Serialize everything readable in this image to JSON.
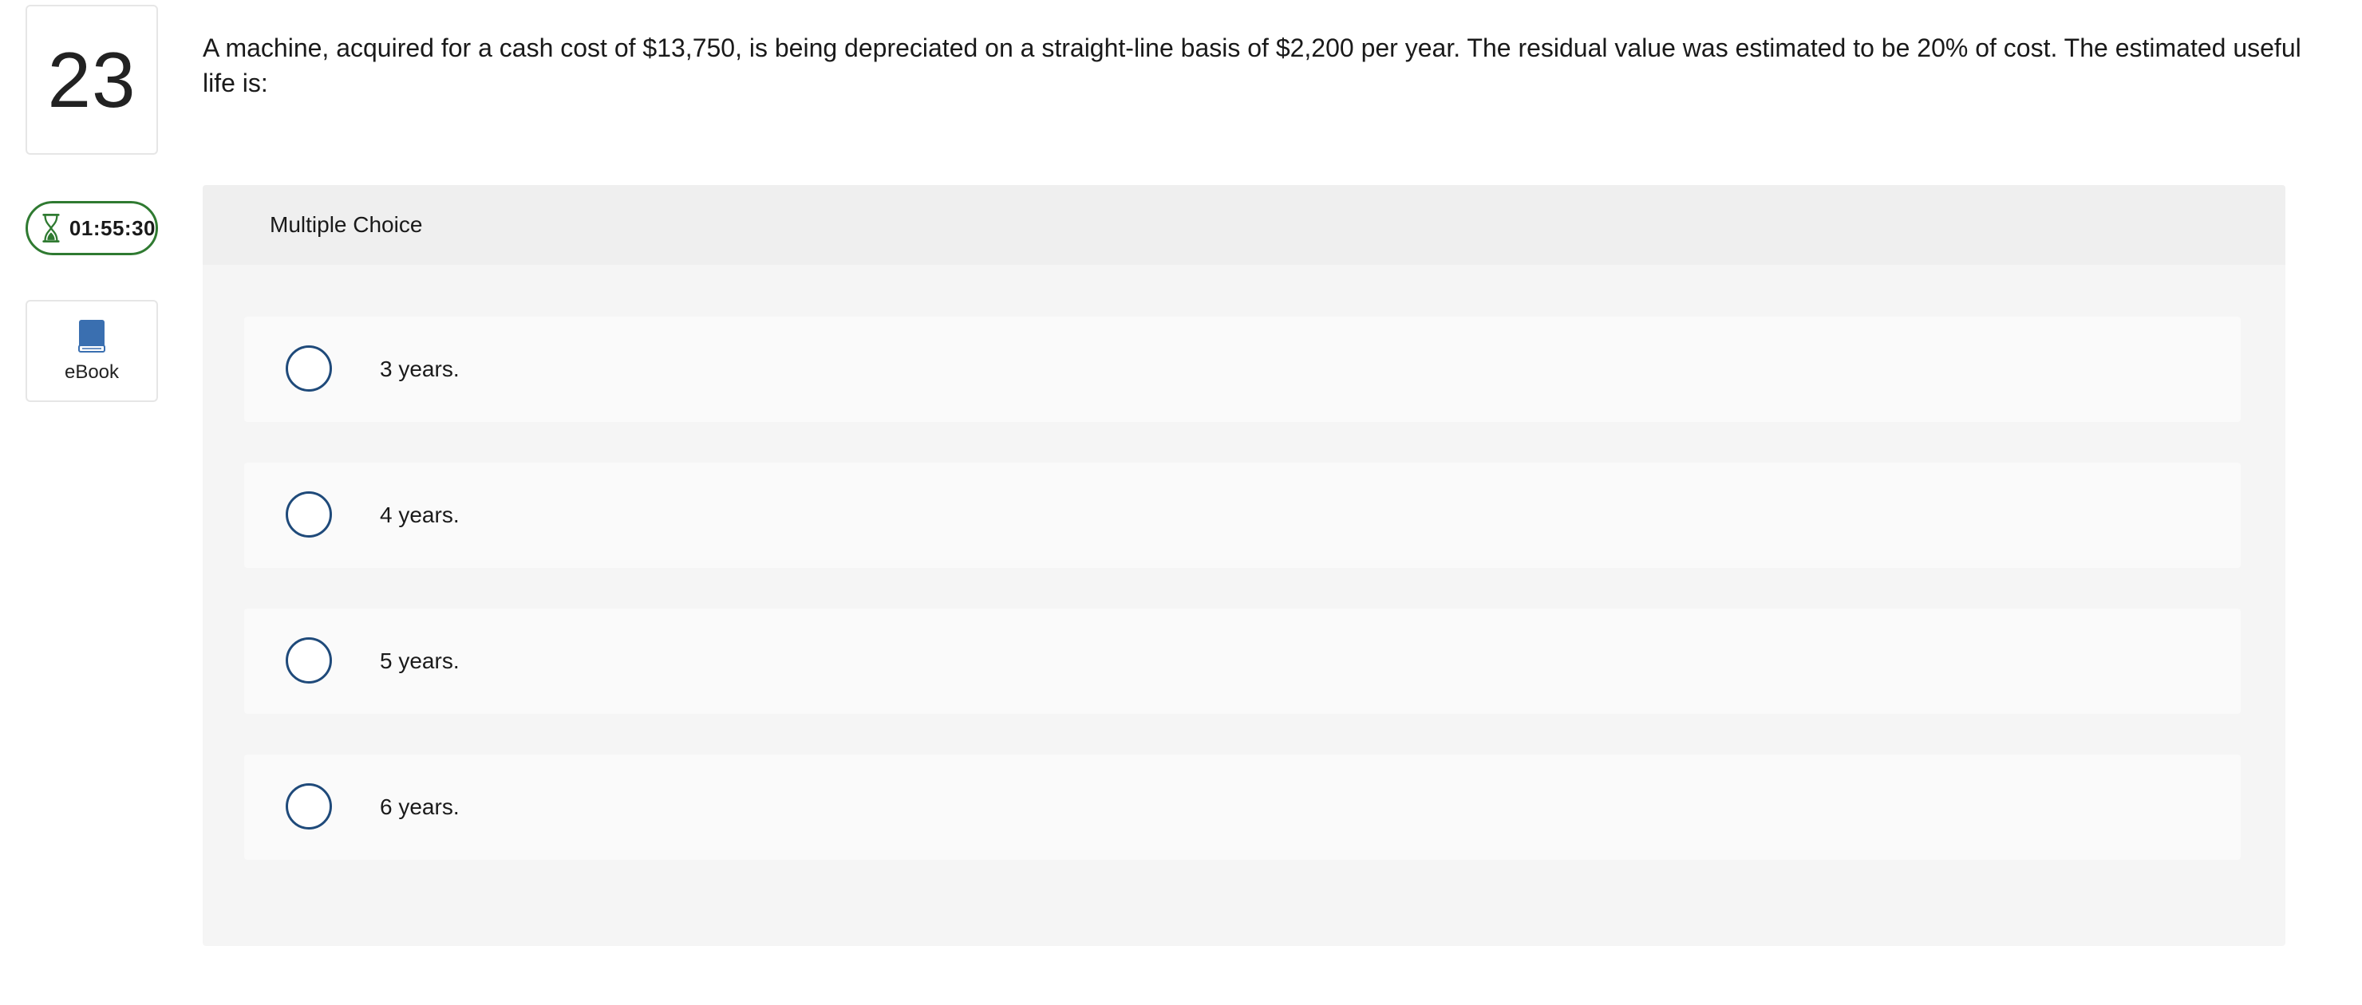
{
  "question": {
    "number": "23",
    "text": "A machine, acquired for a cash cost of $13,750, is being depreciated on a straight-line basis of $2,200 per year. The residual value was estimated to be 20% of cost. The estimated useful life is:"
  },
  "timer": {
    "value": "01:55:30",
    "icon": "hourglass-icon",
    "color": "#2f7a31"
  },
  "ebook": {
    "label": "eBook",
    "icon": "book-icon",
    "color": "#3a6fb0"
  },
  "panel": {
    "header": "Multiple Choice"
  },
  "choices": [
    {
      "label": "3 years."
    },
    {
      "label": "4 years."
    },
    {
      "label": "5 years."
    },
    {
      "label": "6 years."
    }
  ],
  "colors": {
    "radio_border": "#1f4a7a",
    "panel_bg": "#f5f5f5",
    "choice_bg": "#fafafa"
  }
}
